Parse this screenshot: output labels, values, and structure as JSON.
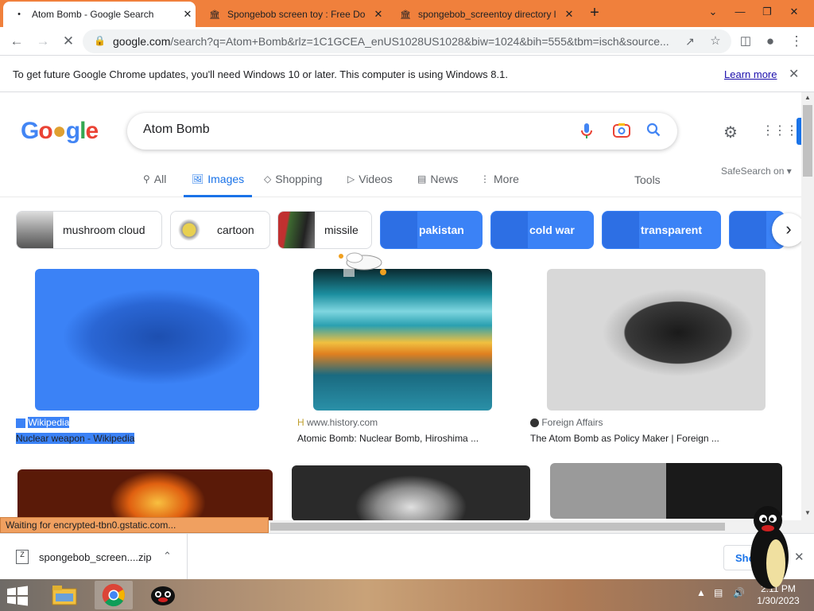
{
  "tabs": [
    {
      "title": "Atom Bomb - Google Search",
      "active": true
    },
    {
      "title": "Spongebob screen toy : Free Do",
      "active": false
    },
    {
      "title": "spongebob_screentoy directory l",
      "active": false
    }
  ],
  "new_tab_label": "+",
  "address": {
    "host": "google.com",
    "path": "/search?q=Atom+Bomb&rlz=1C1GCEA_enUS1028US1028&biw=1024&bih=555&tbm=isch&source..."
  },
  "infobar": {
    "message": "To get future Google Chrome updates, you'll need Windows 10 or later. This computer is using Windows 8.1.",
    "link": "Learn more"
  },
  "search": {
    "query": "Atom Bomb"
  },
  "nav_tabs": [
    {
      "label": "All",
      "icon": "search-icon",
      "selected": false
    },
    {
      "label": "Images",
      "icon": "image-icon",
      "selected": true
    },
    {
      "label": "Shopping",
      "icon": "tag-icon",
      "selected": false
    },
    {
      "label": "Videos",
      "icon": "play-icon",
      "selected": false
    },
    {
      "label": "News",
      "icon": "news-icon",
      "selected": false
    },
    {
      "label": "More",
      "icon": "more-icon",
      "selected": false
    }
  ],
  "tools_label": "Tools",
  "safesearch_label": "SafeSearch on",
  "chips": [
    {
      "label": "mushroom cloud",
      "highlighted": false
    },
    {
      "label": "cartoon",
      "highlighted": false
    },
    {
      "label": "missile",
      "highlighted": false
    },
    {
      "label": "pakistan",
      "highlighted": true
    },
    {
      "label": "cold war",
      "highlighted": true
    },
    {
      "label": "transparent",
      "highlighted": true
    }
  ],
  "results": [
    {
      "source": "Wikipedia",
      "caption": "Nuclear weapon - Wikipedia"
    },
    {
      "source": "www.history.com",
      "caption": "Atomic Bomb: Nuclear Bomb, Hiroshima ..."
    },
    {
      "source": "Foreign Affairs",
      "caption": "The Atom Bomb as Policy Maker | Foreign ..."
    }
  ],
  "status_text": "Waiting for encrypted-tbn0.gstatic.com...",
  "download": {
    "filename": "spongebob_screen....zip",
    "show_all": "Sho"
  },
  "clock": {
    "time": "2:11 PM",
    "date": "1/30/2023"
  },
  "colors": {
    "tab_strip": "#f0803c",
    "accent": "#1a73e8",
    "selection": "#3b82f6"
  }
}
